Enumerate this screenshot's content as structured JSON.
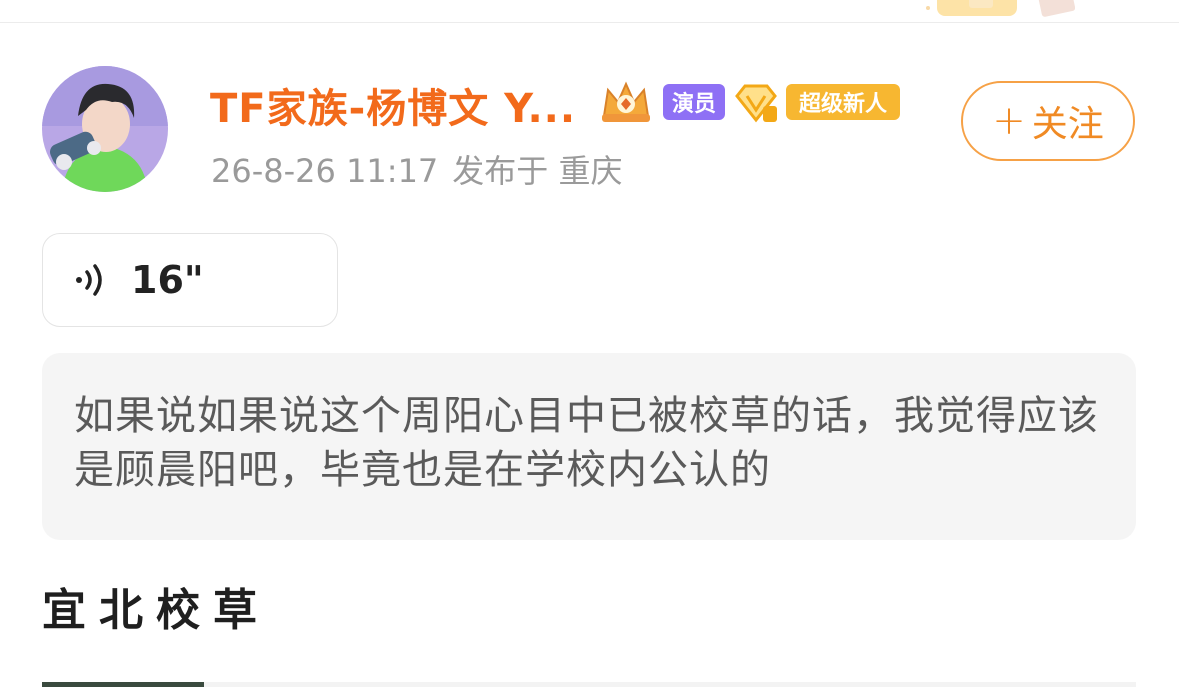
{
  "user": {
    "name": "TF家族-杨博文 Y...",
    "badges": {
      "actor": "演员",
      "newbie": "超级新人"
    },
    "timestamp": "26-8-26 11:17",
    "location": "发布于 重庆"
  },
  "follow_button": {
    "icon": "plus-icon",
    "label": "关注"
  },
  "voice_message": {
    "icon": "sound-wave-icon",
    "duration": "16\""
  },
  "quote": {
    "text": "如果说如果说这个周阳心目中已被校草的话，我觉得应该是顾晨阳吧，毕竟也是在学校内公认的"
  },
  "section": {
    "title": "宜北校草"
  },
  "colors": {
    "name": "#f26a1b",
    "follow_border": "#f6a146",
    "actor_badge": "#8e70f5",
    "newbie_badge": "#f7b731"
  }
}
